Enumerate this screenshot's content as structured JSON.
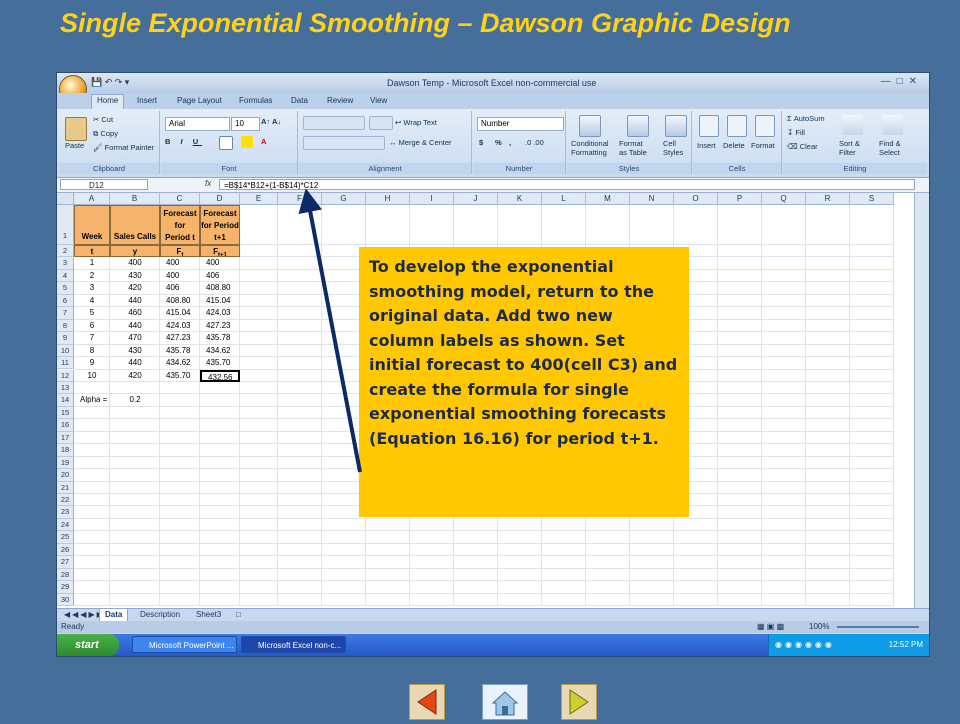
{
  "slide": {
    "title": "Single Exponential Smoothing – Dawson Graphic Design",
    "callout_text": "To develop the exponential smoothing model, return to the original data.  Add two new column labels as shown. Set initial forecast to 400(cell C3) and create the formula for single exponential smoothing forecasts (Equation 16.16) for period t+1."
  },
  "excel": {
    "window_title": "Dawson Temp  -  Microsoft Excel non-commercial use",
    "tabs": [
      "Home",
      "Insert",
      "Page Layout",
      "Formulas",
      "Data",
      "Review",
      "View"
    ],
    "active_tab": "Home",
    "ribbon": {
      "clipboard": {
        "label": "Clipboard",
        "paste": "Paste",
        "cut": "Cut",
        "copy": "Copy",
        "format_painter": "Format Painter"
      },
      "font": {
        "label": "Font",
        "font_name": "Arial",
        "font_size": "10"
      },
      "alignment": {
        "label": "Alignment",
        "wrap_text": "Wrap Text",
        "merge_center": "Merge & Center"
      },
      "number": {
        "label": "Number",
        "format": "Number",
        "currency": "$",
        "percent": "%",
        "comma": ","
      },
      "styles": {
        "label": "Styles",
        "conditional": "Conditional",
        "formatting": "Formatting",
        "format_as": "Format",
        "as_table": "as Table",
        "cell": "Cell",
        "styles": "Styles"
      },
      "cells": {
        "label": "Cells",
        "insert": "Insert",
        "delete": "Delete",
        "format": "Format"
      },
      "editing": {
        "label": "Editing",
        "autosum": "AutoSum",
        "fill": "Fill",
        "clear": "Clear",
        "sort": "Sort &",
        "filter": "Filter",
        "find": "Find &",
        "select": "Select"
      }
    },
    "name_box": "D12",
    "fx": "fx",
    "formula": "=B$14*B12+(1-B$14)*C12",
    "columns": [
      "A",
      "B",
      "C",
      "D",
      "E",
      "F",
      "G",
      "H",
      "I",
      "J",
      "K",
      "L",
      "M",
      "N",
      "O",
      "P",
      "Q",
      "R",
      "S"
    ],
    "rows": [
      "1",
      "2",
      "3",
      "4",
      "5",
      "6",
      "7",
      "8",
      "9",
      "10",
      "11",
      "12",
      "13",
      "14",
      "15",
      "16",
      "17",
      "18",
      "19",
      "20",
      "21",
      "22",
      "23",
      "24",
      "25",
      "26",
      "27",
      "28",
      "29",
      "30"
    ],
    "headers": {
      "week": "Week",
      "sales_calls": "Sales Calls",
      "forecast_for_period_t": [
        "Forecast",
        "for",
        "Period t"
      ],
      "forecast_for_period_t1": [
        "Forecast",
        "for Period",
        "t+1"
      ]
    },
    "row2": {
      "t": "t",
      "y": "y",
      "ft": "F",
      "ft_sub": "t",
      "ft1": "F",
      "ft1_sub": "t+1"
    },
    "data_rows": [
      [
        "1",
        "400",
        "400",
        "400"
      ],
      [
        "2",
        "430",
        "400",
        "406"
      ],
      [
        "3",
        "420",
        "406",
        "408.80"
      ],
      [
        "4",
        "440",
        "408.80",
        "415.04"
      ],
      [
        "5",
        "460",
        "415.04",
        "424.03"
      ],
      [
        "6",
        "440",
        "424.03",
        "427.23"
      ],
      [
        "7",
        "470",
        "427.23",
        "435.78"
      ],
      [
        "8",
        "430",
        "435.78",
        "434.62"
      ],
      [
        "9",
        "440",
        "434.62",
        "435.70"
      ],
      [
        "10",
        "420",
        "435.70",
        "432.56"
      ]
    ],
    "alpha_label": "Alpha =",
    "alpha_value": "0.2",
    "sheet_tabs": [
      "Data",
      "Description",
      "Sheet3"
    ],
    "active_sheet": "Data",
    "status": "Ready",
    "zoom": "100%",
    "taskbar": {
      "start": "start",
      "items": [
        "Microsoft PowerPoint ...",
        "Microsoft Excel non-c..."
      ],
      "clock": "12:52 PM"
    }
  },
  "colors": {
    "slide_bg": "#466e9b",
    "title": "#ffd21a",
    "callout_bg": "#ffc800",
    "header_fill": "#f5b36b",
    "arrow": "#0c2a66"
  },
  "nav": [
    "back-icon",
    "home-icon",
    "forward-icon"
  ]
}
